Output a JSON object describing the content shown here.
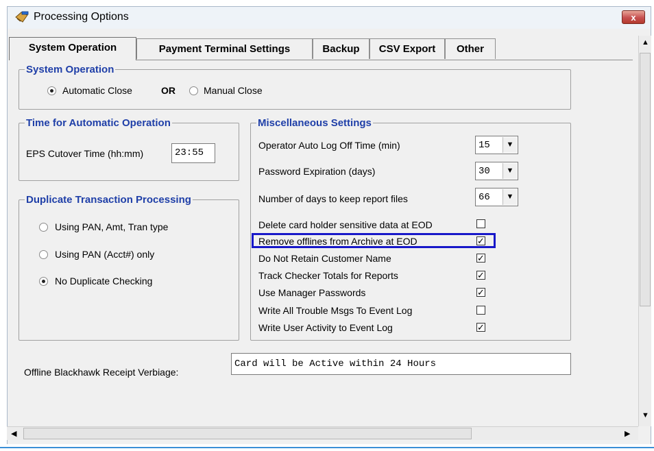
{
  "window": {
    "title": "Processing Options",
    "close_glyph": "x"
  },
  "tabs": [
    {
      "label": "System Operation",
      "active": true
    },
    {
      "label": "Payment Terminal Settings",
      "active": false
    },
    {
      "label": "Backup",
      "active": false
    },
    {
      "label": "CSV Export",
      "active": false
    },
    {
      "label": "Other",
      "active": false
    }
  ],
  "system_operation": {
    "legend": "System Operation",
    "automatic_label": "Automatic Close",
    "or_label": "OR",
    "manual_label": "Manual Close",
    "selected": "automatic"
  },
  "time_auto": {
    "legend": "Time for Automatic Operation",
    "cutover_label": "EPS Cutover Time (hh:mm)",
    "cutover_value": "23:55"
  },
  "duplicate": {
    "legend": "Duplicate Transaction Processing",
    "options": [
      {
        "label": "Using PAN, Amt, Tran type",
        "selected": false
      },
      {
        "label": "Using PAN (Acct#) only",
        "selected": false
      },
      {
        "label": "No Duplicate Checking",
        "selected": true
      }
    ]
  },
  "misc": {
    "legend": "Miscellaneous Settings",
    "dropdowns": [
      {
        "label": "Operator Auto Log Off Time (min)",
        "value": "15"
      },
      {
        "label": "Password Expiration (days)",
        "value": "30"
      },
      {
        "label": "Number of days to keep report files",
        "value": "66"
      }
    ],
    "checkboxes": [
      {
        "label": "Delete card holder sensitive data at EOD",
        "checked": false
      },
      {
        "label": "Remove offlines from Archive at EOD",
        "checked": true
      },
      {
        "label": "Do Not Retain Customer Name",
        "checked": true
      },
      {
        "label": "Track Checker Totals for Reports",
        "checked": true
      },
      {
        "label": "Use Manager Passwords",
        "checked": true
      },
      {
        "label": "Write All Trouble Msgs To Event Log",
        "checked": false
      },
      {
        "label": "Write User Activity to Event Log",
        "checked": true
      }
    ]
  },
  "receipt": {
    "label": "Offline Blackhawk Receipt Verbiage:",
    "value": "Card will be Active within 24 Hours"
  },
  "glyphs": {
    "check": "✓",
    "down_arrow": "▼",
    "up_arrow": "▲",
    "left_arrow": "◀",
    "right_arrow": "▶"
  },
  "colors": {
    "legend": "#1f3fa8",
    "highlight": "#1717c9"
  }
}
